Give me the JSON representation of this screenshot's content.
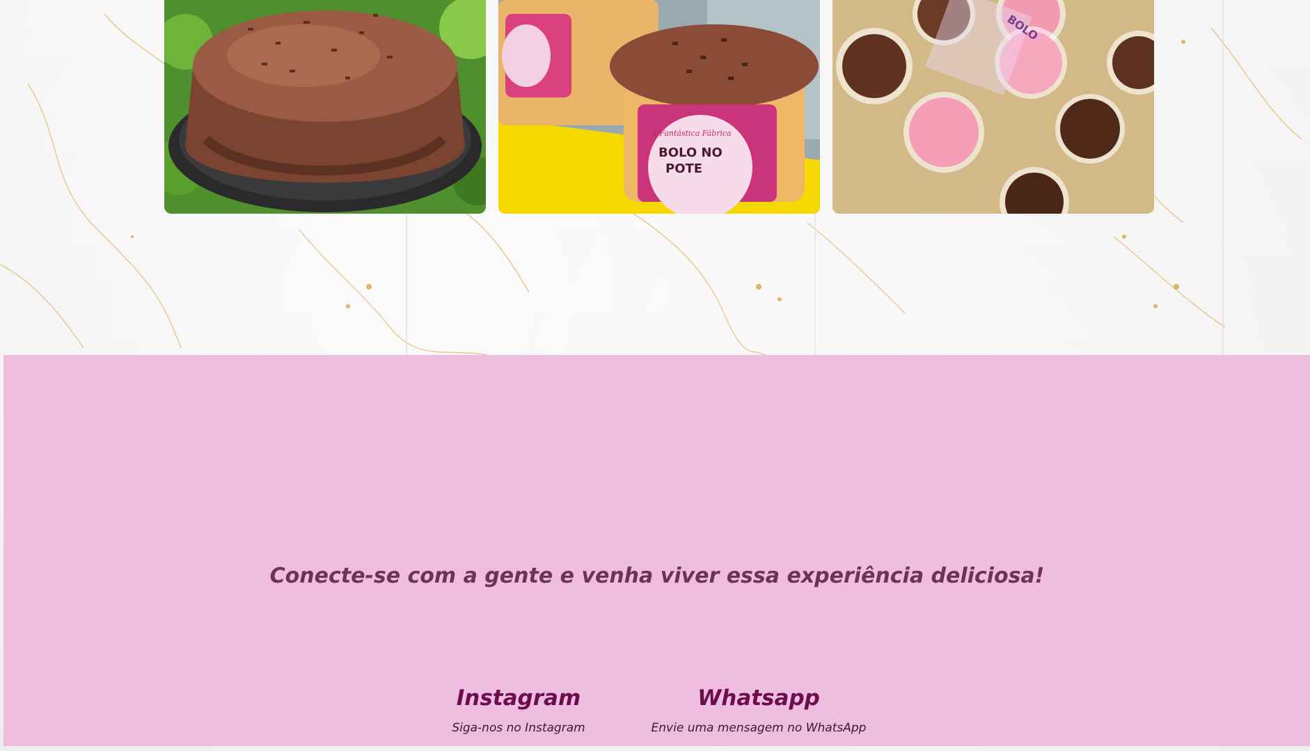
{
  "gallery": {
    "photos": [
      {
        "name": "chocolate-cake-photo"
      },
      {
        "name": "bolo-no-pote-photo",
        "label_line1": "BOLO NO",
        "label_line2": "POTE",
        "brand": "A Fantástica Fábrica"
      },
      {
        "name": "brigadeiros-photo",
        "package_text": "BOLO"
      }
    ]
  },
  "contact_section": {
    "tagline": "Conecte-se com a gente e venha viver essa experiência deliciosa!",
    "instagram": {
      "title": "Instagram",
      "subtitle": "Siga-nos no Instagram"
    },
    "whatsapp": {
      "title": "Whatsapp",
      "subtitle": "Envie uma mensagem no WhatsApp"
    }
  },
  "colors": {
    "pink_background": "#efbde0",
    "tagline": "#6b3358",
    "link_title": "#6c0d4e"
  }
}
